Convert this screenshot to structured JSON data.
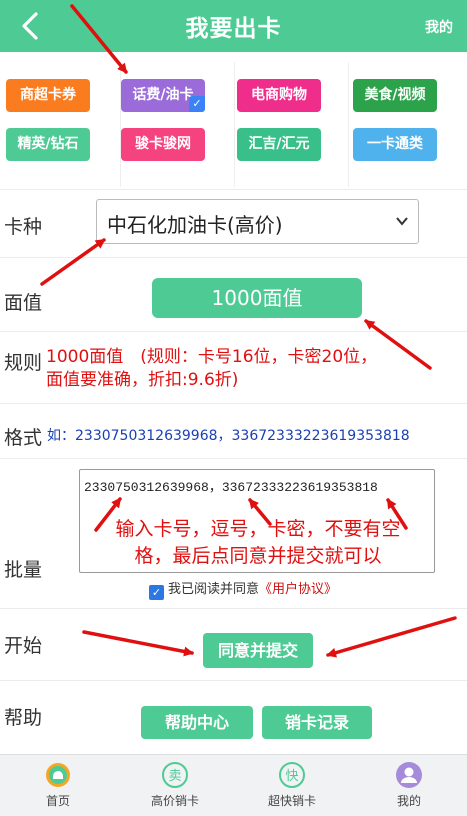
{
  "header": {
    "title": "我要出卡",
    "right_link": "我的"
  },
  "categories": [
    {
      "label": "商超卡券",
      "color": "#fb7c1e",
      "selected": false
    },
    {
      "label": "话费/油卡",
      "color": "#9b6cd9",
      "selected": true
    },
    {
      "label": "电商购物",
      "color": "#ef2e8c",
      "selected": false
    },
    {
      "label": "美食/视频",
      "color": "#2ca34a",
      "selected": false
    },
    {
      "label": "精英/钻石",
      "color": "#4ecb94",
      "selected": false
    },
    {
      "label": "骏卡骏网",
      "color": "#f4437f",
      "selected": false
    },
    {
      "label": "汇吉/汇元",
      "color": "#39c08a",
      "selected": false
    },
    {
      "label": "一卡通类",
      "color": "#4fb2ec",
      "selected": false
    }
  ],
  "labels": {
    "card_type": "卡种",
    "face_value": "面值",
    "rules": "规则",
    "format": "格式",
    "batch": "批量",
    "start": "开始",
    "help": "帮助"
  },
  "card_type_select": {
    "value": "中石化加油卡(高价)"
  },
  "face_value_button": "1000面值",
  "rule_text": "1000面值　(规则：卡号16位，卡密20位，面值要准确，折扣:9.6折)",
  "format_text": "如：2330750312639968，33672333223619353818",
  "batch_input": {
    "value": "2330750312639968，33672333223619353818",
    "annotation": "输入卡号，逗号，卡密，不要有空格，最后点同意并提交就可以"
  },
  "agreement": {
    "checked": true,
    "text": "我已阅读并同意",
    "link": "《用户协议》"
  },
  "submit_button": "同意并提交",
  "help_buttons": {
    "help_center": "帮助中心",
    "sell_record": "销卡记录"
  },
  "tabbar": [
    {
      "label": "首页",
      "icon": "home-icon",
      "color": "#f5a623"
    },
    {
      "label": "高价销卡",
      "icon": "sell-icon",
      "color": "#4ecb94"
    },
    {
      "label": "超快销卡",
      "icon": "fast-icon",
      "color": "#4ecb94"
    },
    {
      "label": "我的",
      "icon": "user-icon",
      "color": "#a78bdb"
    }
  ]
}
